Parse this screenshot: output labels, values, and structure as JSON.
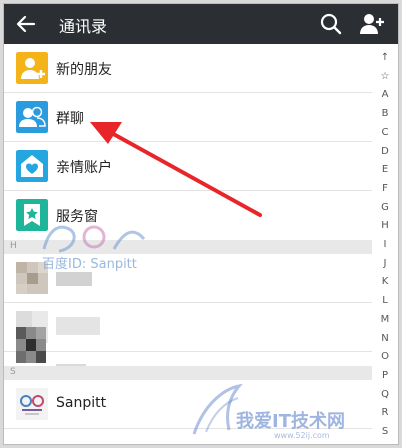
{
  "titlebar": {
    "title": "通讯录"
  },
  "list": {
    "items": [
      {
        "label": "新的朋友",
        "icon": "new-friend-icon",
        "color": "#f5b31a"
      },
      {
        "label": "群聊",
        "icon": "group-chat-icon",
        "color": "#2a9bdc"
      },
      {
        "label": "亲情账户",
        "icon": "family-account-icon",
        "color": "#25a6e0"
      },
      {
        "label": "服务窗",
        "icon": "service-window-icon",
        "color": "#1fb59b"
      }
    ],
    "section_h": "H",
    "section_s": "S",
    "contact_sanpitt": "Sanpitt"
  },
  "index_bar": [
    "↑",
    "☆",
    "A",
    "B",
    "C",
    "D",
    "E",
    "F",
    "G",
    "H",
    "I",
    "J",
    "K",
    "L",
    "M",
    "N",
    "O",
    "P",
    "Q",
    "R",
    "S"
  ],
  "watermarks": {
    "left_text": "百度ID: Sanpitt",
    "right_text": "我爱IT技术网",
    "right_url": "www.52ij.com"
  },
  "annotation": {
    "color": "#e8262a"
  }
}
